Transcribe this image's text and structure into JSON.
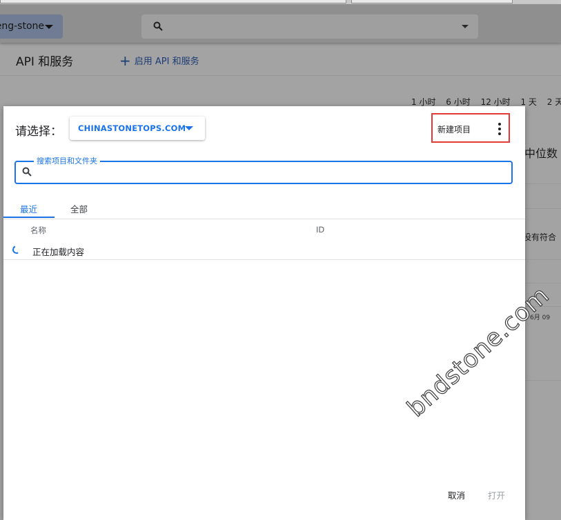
{
  "header": {
    "project_selector": "eng-stone",
    "page_title": "API 和服务",
    "enable_apis_label": "启用 API 和服务"
  },
  "background": {
    "time_ranges": [
      "1 小时",
      "6 小时",
      "12 小时",
      "1 天",
      "2 天"
    ],
    "median_label": "中位数",
    "no_match_text": "没有符合",
    "date_label": "6月 09"
  },
  "dialog": {
    "select_label": "请选择：",
    "organization": "CHINASTONETOPS.COM",
    "new_project_label": "新建项目",
    "search_label": "搜索项目和文件夹",
    "search_value": "",
    "tabs": [
      {
        "label": "最近",
        "active": true
      },
      {
        "label": "全部",
        "active": false
      }
    ],
    "columns": {
      "name": "名称",
      "id": "ID"
    },
    "loading_text": "正在加载内容",
    "cancel_label": "取消",
    "open_label": "打开"
  },
  "watermark": "bndstone.com",
  "colors": {
    "accent": "#1a73e8",
    "highlight_box": "#e53935",
    "disabled": "#9aa0a6"
  }
}
